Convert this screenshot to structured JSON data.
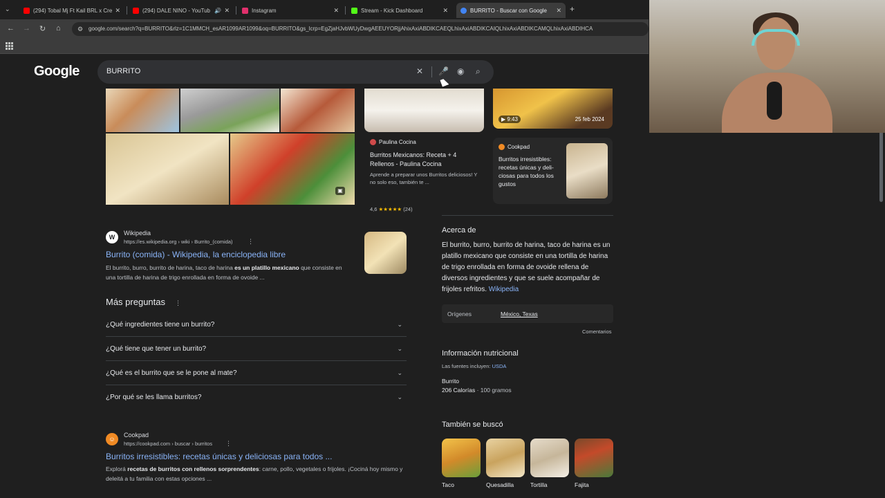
{
  "browser": {
    "tabs": [
      {
        "title": "(294) Tobal Mj Ft Kail BRL x Cre",
        "color": "#ff0000"
      },
      {
        "title": "(294) DALE NINO - YouTub",
        "color": "#ff0000"
      },
      {
        "title": "Instagram",
        "color": "#e1306c"
      },
      {
        "title": "Stream - Kick Dashboard",
        "color": "#53fc18"
      },
      {
        "title": "BURRITO - Buscar con Google",
        "color": "#4285f4"
      }
    ],
    "new_tab": "+",
    "url": "google.com/search?q=BURRITO&rlz=1C1MMCH_esAR1099AR1099&oq=BURRITO&gs_lcrp=EgZjaHJvbWUyDwgAEEUYORjjAhixAxiABDIKCAEQLhixAxiABDIKCAIQLhixAxiABDIKCAMQLhixAxiABDIHCA"
  },
  "search": {
    "logo": "Google",
    "query": "BURRITO"
  },
  "image_cards": {
    "paulina": {
      "source": "Paulina Cocina",
      "title": "Burritos Mexicanos: Receta + 4 Rellenos - Paulina Cocina",
      "desc": "Aprende a preparar unos Burritos deliciosos! Y no solo eso, también te ...",
      "rating_value": "4,6",
      "stars": "★★★★★",
      "rating_count": "(24)"
    },
    "video": {
      "duration": "▶ 9:43",
      "date": "25 feb 2024"
    },
    "cookpad": {
      "source": "Cookpad",
      "title": "Burritos irresistibles: recetas únicas y deli-ciosas para todos los gustos"
    }
  },
  "results": [
    {
      "site": "Wikipedia",
      "url": "https://es.wikipedia.org › wiki › Burrito_(comida)",
      "title": "Burrito (comida) - Wikipedia, la enciclopedia libre",
      "snippet_pre": "El burrito, burro, burrito de harina, taco de harina ",
      "snippet_bold": "es un platillo mexicano",
      "snippet_post": " que consiste en una tortilla de harina de trigo enrollada en forma de ovoide ..."
    },
    {
      "site": "Cookpad",
      "url": "https://cookpad.com › buscar › burritos",
      "title": "Burritos irresistibles: recetas únicas y deliciosas para todos ...",
      "snippet_pre": "Explorá ",
      "snippet_bold": "recetas de burritos con rellenos sorprendentes",
      "snippet_post": ": carne, pollo, vegetales o frijoles. ¡Cociná hoy mismo y deleitá a tu familia con estas opciones ..."
    }
  ],
  "paa": {
    "title": "Más preguntas",
    "questions": [
      "¿Qué ingredientes tiene un burrito?",
      "¿Qué tiene que tener un burrito?",
      "¿Qué es el burrito que se le pone al mate?",
      "¿Por qué se les llama burritos?"
    ]
  },
  "knowledge_panel": {
    "about_title": "Acerca de",
    "about_text": "El burrito, burro, burrito de harina, taco de harina es un platillo mexicano que consiste en una tortilla de harina de trigo enrollada en forma de ovoide rellena de diversos ingredientes y que se suele acompañar de frijoles refritos.",
    "about_link": "Wikipedia",
    "origin_label": "Orígenes",
    "origin_value": "México, Texas",
    "feedback": "Comentarios",
    "nutrition_title": "Información nutricional",
    "sources_label": "Las fuentes incluyen:",
    "sources_value": "USDA",
    "item_name": "Burrito",
    "calories": "206 Calorías",
    "portion": "· 100 gramos",
    "related_title": "También se buscó",
    "related": [
      "Taco",
      "Quesadilla",
      "Tortilla",
      "Fajita"
    ]
  },
  "icons": {
    "search": "search-icon",
    "mic": "microphone-icon",
    "lens": "camera-lens-icon",
    "clear": "close-icon"
  }
}
